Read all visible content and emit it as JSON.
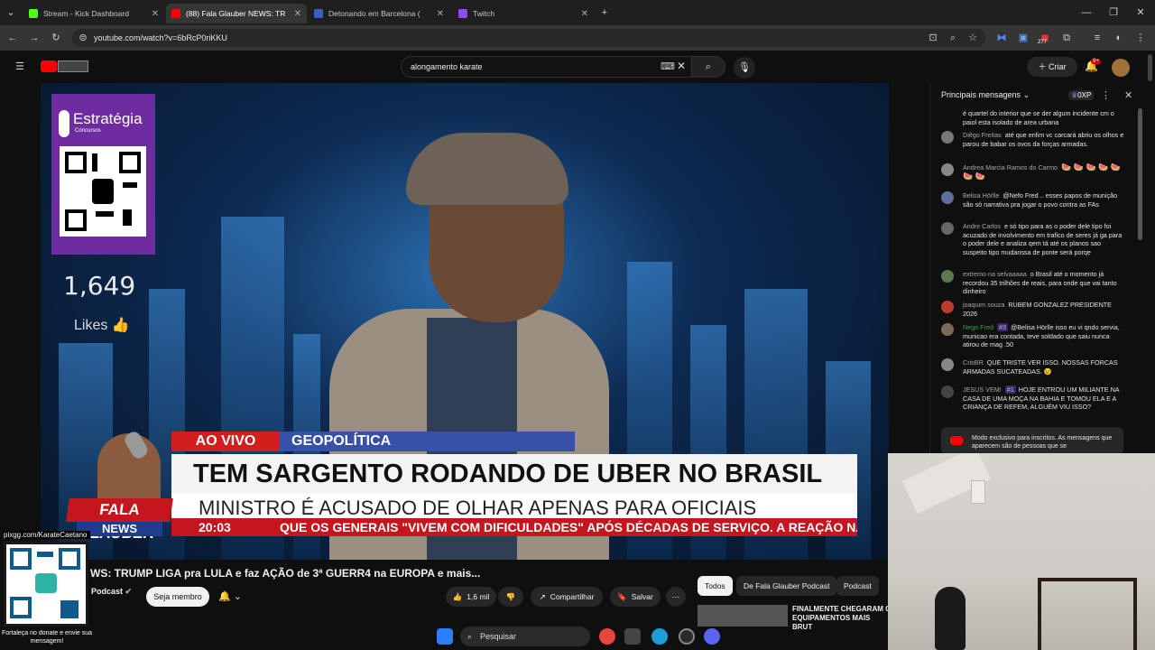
{
  "browser": {
    "tabs": [
      {
        "label": "Stream - Kick Dashboard",
        "color": "#53fc18"
      },
      {
        "label": "(88) Fala Glauber NEWS: TR",
        "color": "#ff0000"
      },
      {
        "label": "Detonando em Barcelona (",
        "color": "#3b5ec2"
      },
      {
        "label": "Twitch",
        "color": "#9146ff"
      }
    ],
    "url": "youtube.com/watch?v=6bRcP0riKKU",
    "badge_count": "277"
  },
  "youtube": {
    "search_value": "alongamento karate",
    "create_label": "Criar",
    "notif_count": "9+"
  },
  "video": {
    "sponsor_name": "Estratégia",
    "sponsor_sub": "Concursos",
    "likes_count": "1,649",
    "likes_label": "Likes",
    "live_label": "AO VIVO",
    "topic": "GEOPOLÍTICA",
    "headline": "TEM SARGENTO RODANDO DE UBER NO BRASIL",
    "subheadline": "MINISTRO É ACUSADO DE OLHAR APENAS PARA OFICIAIS",
    "time": "20:03",
    "ticker": "QUE OS GENERAIS \"VIVEM COM DIFICULDADES\" APÓS DÉCADAS DE SERVIÇO. A REAÇÃO NAS F",
    "logo_top": "FALA GLAUBER",
    "logo_bottom": "NEWS"
  },
  "below": {
    "title": "WS: TRUMP LIGA pra LULA e faz AÇÃO de 3ª GUERR4 na EUROPA e mais...",
    "channel": "Podcast",
    "join": "Seja membro",
    "likes": "1,6 mil",
    "share": "Compartilhar",
    "save": "Salvar",
    "chips": [
      "Todos",
      "De Fala Glauber Podcast",
      "Podcast"
    ],
    "rec_title": "FINALMENTE CHEGARAM O EQUIPAMENTOS MAIS BRUT"
  },
  "chat": {
    "header": "Principais mensagens",
    "points": "0XP",
    "messages": [
      {
        "author": "",
        "text": "é quartel do interior que se der algum incidente cm o paiol esta isolado de area urbana",
        "color": "#555"
      },
      {
        "author": "Diêgo Freitas",
        "text": "até que enfim vc carcará abriu os olhos e parou de babar os ovos da forças armadas.",
        "color": "#777"
      },
      {
        "author": "Andrea Marcia Ramos do Carmo",
        "text": "🍉 🍉 🍉 🍉 🍉 🍉 🍉",
        "color": "#888"
      },
      {
        "author": "Belisa Hörlle",
        "text": "@Nefo Fred .. esses papos de munição são só narrativa pra jogar o povo contra as FAs",
        "color": "#5a6f9a"
      },
      {
        "author": "Andre Carlos",
        "text": "e só tipo para as o poder dele tipo foi acuzado de involvimento em trafico de seres já ga para o poder dele e analiza qem tá até os planos sao suspeito tipo mudanssa de ponte será porqe",
        "color": "#666"
      },
      {
        "author": "extremo na selvaaaaa",
        "text": "o Brasil até o momento já recordou 35 trilhões de reais, para onde que vai tanto dinheiro",
        "color": "#5b7a4f"
      },
      {
        "author": "joaquim souza",
        "text": "RUBEM GONZALEZ PRESIDENTE 2026",
        "color": "#c0392b"
      },
      {
        "author": "Nego Fred",
        "badge": "#3",
        "text": "@Belisa Hörlle isso eu vi qndo servia, municao era contada, teve soldado que saiu nunca atirou de mag .50",
        "color": "#7b6a5a"
      },
      {
        "author": "CrisBR",
        "text": "QUE TRISTE VER ISSO. NOSSAS FORCAS ARMADAS SUCATEADAS. 😢",
        "color": "#888"
      },
      {
        "author": "JESUS VEM!",
        "badge": "#1",
        "text": "HOJE ENTROU UM MILIANTE NA CASA DE UMA MOÇA NA BAHIA E TOMOU ELA E A CRIANÇA DE REFEM, ALGUÉM VIU ISSO?",
        "color": "#444"
      }
    ],
    "notice": "Modo exclusivo para inscritos. As mensagens que aparecem são de pessoas que se"
  },
  "pix": {
    "label": "pixgg.com/KarateCaetano",
    "caption": "Fortaleça no donate e envie sua mensagem!"
  },
  "taskbar": {
    "search": "Pesquisar"
  }
}
